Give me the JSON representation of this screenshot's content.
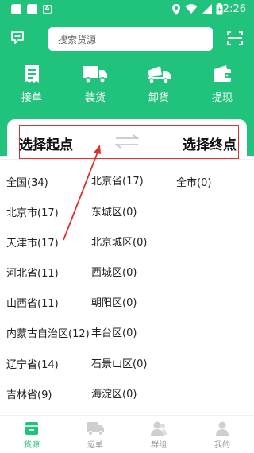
{
  "status_bar": {
    "time": "2:26"
  },
  "search": {
    "placeholder": "搜索货源"
  },
  "actions": [
    {
      "label": "接单",
      "icon": "receipt-icon"
    },
    {
      "label": "装货",
      "icon": "truck-icon"
    },
    {
      "label": "卸货",
      "icon": "unload-truck-icon"
    },
    {
      "label": "提现",
      "icon": "wallet-icon"
    }
  ],
  "selector": {
    "start_label": "选择起点",
    "end_label": "选择终点"
  },
  "regions": {
    "provinces": [
      "全国(34)",
      "北京市(17)",
      "天津市(17)",
      "河北省(11)",
      "山西省(11)",
      "内蒙古自治区(12)",
      "辽宁省(14)",
      "吉林省(9)"
    ],
    "cities": [
      "北京省(17)",
      "东城区(0)",
      "北京城区(0)",
      "西城区(0)",
      "朝阳区(0)",
      "丰台区(0)",
      "石景山区(0)",
      "海淀区(0)"
    ],
    "districts": [
      "全市(0)"
    ]
  },
  "tabs": [
    {
      "label": "货源",
      "icon": "cargo-icon",
      "active": true
    },
    {
      "label": "运单",
      "icon": "waybill-truck-icon",
      "active": false
    },
    {
      "label": "群组",
      "icon": "group-icon",
      "active": false
    },
    {
      "label": "我的",
      "icon": "profile-icon",
      "active": false
    }
  ],
  "colors": {
    "brand_green": "#21c27c",
    "highlight_red": "#d9322f"
  }
}
